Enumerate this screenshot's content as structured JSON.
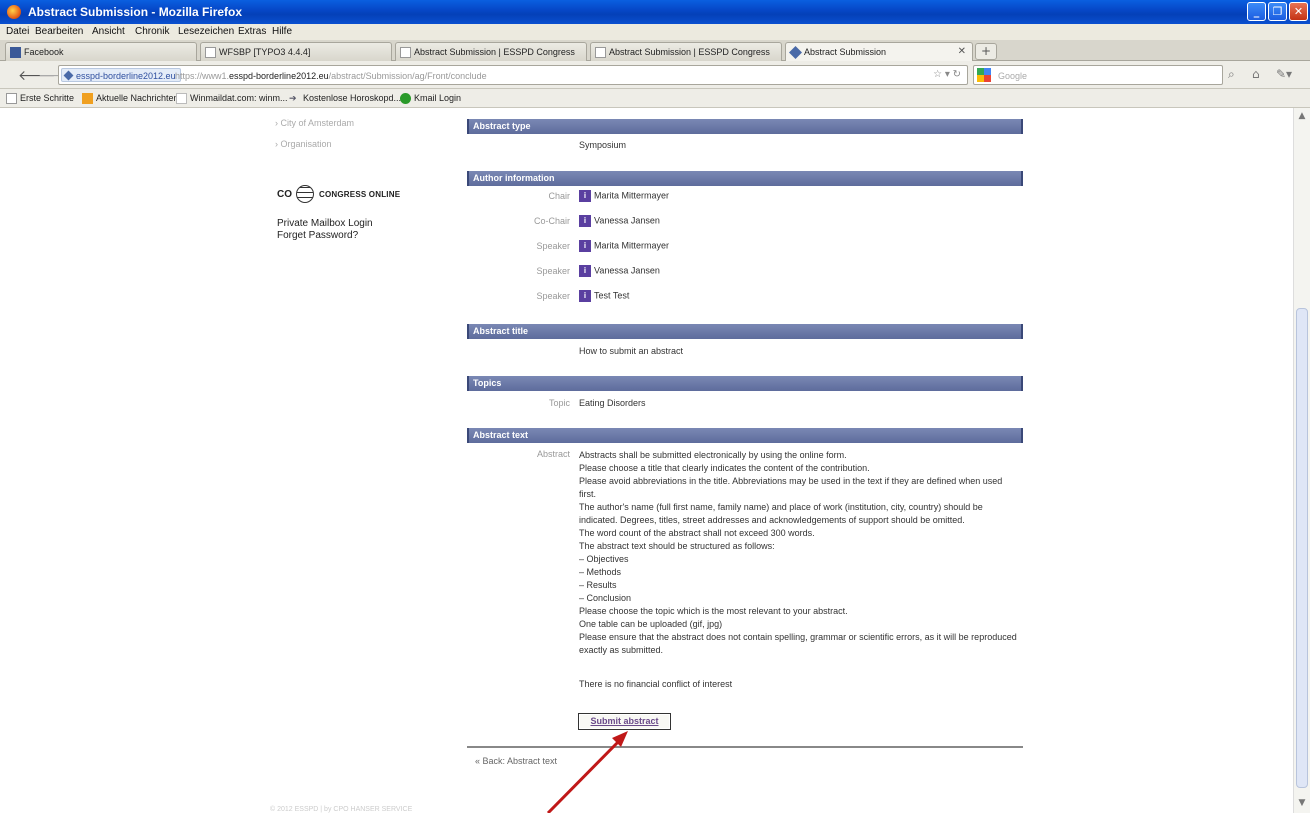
{
  "window": {
    "title": "Abstract Submission - Mozilla Firefox"
  },
  "menu": [
    "Datei",
    "Bearbeiten",
    "Ansicht",
    "Chronik",
    "Lesezeichen",
    "Extras",
    "Hilfe"
  ],
  "tabs": [
    {
      "label": "Facebook"
    },
    {
      "label": "WFSBP [TYPO3 4.4.4]"
    },
    {
      "label": "Abstract Submission | ESSPD Congress"
    },
    {
      "label": "Abstract Submission | ESSPD Congress"
    },
    {
      "label": "Abstract Submission"
    }
  ],
  "nav": {
    "site_badge": "esspd-borderline2012.eu",
    "url_prefix": "https://www1.",
    "url_domain": "esspd-borderline2012.eu",
    "url_rest": "/abstract/Submission/ag/Front/conclude",
    "search_placeholder": "Google"
  },
  "bookmarks": [
    "Erste Schritte",
    "Aktuelle Nachrichten",
    "Winmaildat.com: winm...",
    "Kostenlose Horoskopd...",
    "Kmail Login"
  ],
  "sidebar": {
    "nav_items": [
      "City of Amsterdam",
      "Organisation"
    ],
    "logo_co": "CO",
    "logo_label": "CONGRESS ONLINE",
    "links": [
      "Private Mailbox Login",
      "Forget Password?"
    ]
  },
  "sections": {
    "abstract_type": {
      "title": "Abstract type",
      "value": "Symposium"
    },
    "author_info": {
      "title": "Author information",
      "rows": [
        {
          "role": "Chair",
          "name": "Marita Mittermayer"
        },
        {
          "role": "Co-Chair",
          "name": "Vanessa Jansen"
        },
        {
          "role": "Speaker",
          "name": "Marita Mittermayer"
        },
        {
          "role": "Speaker",
          "name": "Vanessa Jansen"
        },
        {
          "role": "Speaker",
          "name": "Test Test"
        }
      ]
    },
    "abstract_title": {
      "title": "Abstract title",
      "value": "How to submit an abstract"
    },
    "topics": {
      "title": "Topics",
      "label": "Topic",
      "value": "Eating Disorders"
    },
    "abstract_text": {
      "title": "Abstract text",
      "label": "Abstract",
      "lines": [
        "Abstracts shall be submitted electronically by using the online form.",
        "Please choose a title that clearly indicates the content of the contribution.",
        "Please avoid abbreviations in the title. Abbreviations may be used in the text if they are defined when used first.",
        "The author's name (full first name, family name) and place of work (institution, city, country) should be indicated. Degrees, titles, street addresses and acknowledgements of support should be omitted.",
        "The word count of the abstract shall not exceed 300 words.",
        "The abstract text should be structured as follows:",
        "– Objectives",
        "– Methods",
        "– Results",
        "– Conclusion",
        "Please choose the topic which is the most relevant to your abstract.",
        "One table can be uploaded (gif, jpg)",
        "Please ensure that the abstract does not contain spelling, grammar or scientific errors, as it will be reproduced exactly as submitted."
      ],
      "conflict": "There is no financial conflict of interest"
    }
  },
  "actions": {
    "submit": "Submit abstract",
    "back": "« Back: Abstract text"
  },
  "footer": "© 2012 ESSPD | by CPO HANSER SERVICE",
  "colors": {
    "section_header": "#6a78a8",
    "arrow": "#c01818",
    "titlebar": "#0a50d0"
  }
}
